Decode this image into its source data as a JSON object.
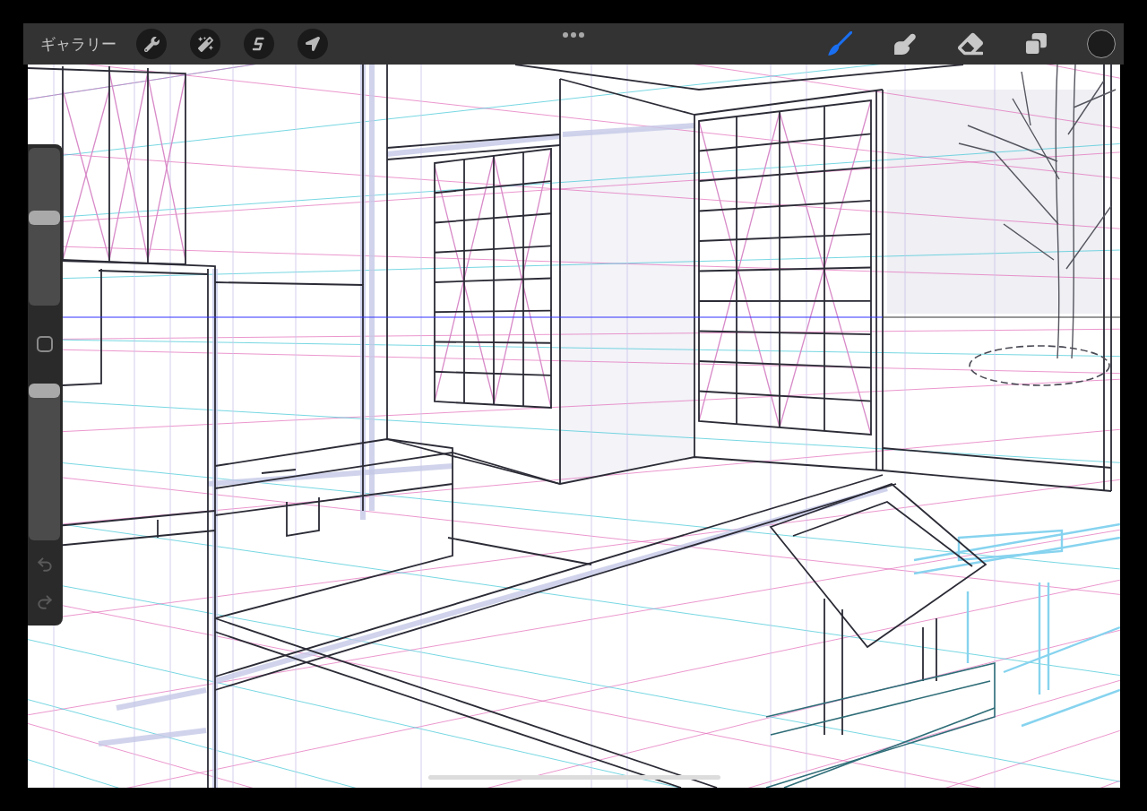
{
  "top_bar": {
    "gallery_label": "ギャラリー",
    "actions": [
      {
        "kind": "wrench"
      },
      {
        "kind": "wand"
      },
      {
        "kind": "selection"
      },
      {
        "kind": "transform"
      }
    ],
    "tools": [
      {
        "kind": "brush",
        "selected": true
      },
      {
        "kind": "smudge",
        "selected": false
      },
      {
        "kind": "eraser",
        "selected": false
      }
    ],
    "color_swatch": {
      "color": "#1c1c1c"
    }
  },
  "sidebar": {
    "size_slider": {
      "level": 0.56
    },
    "opacity_slider": {
      "level": 1
    }
  }
}
